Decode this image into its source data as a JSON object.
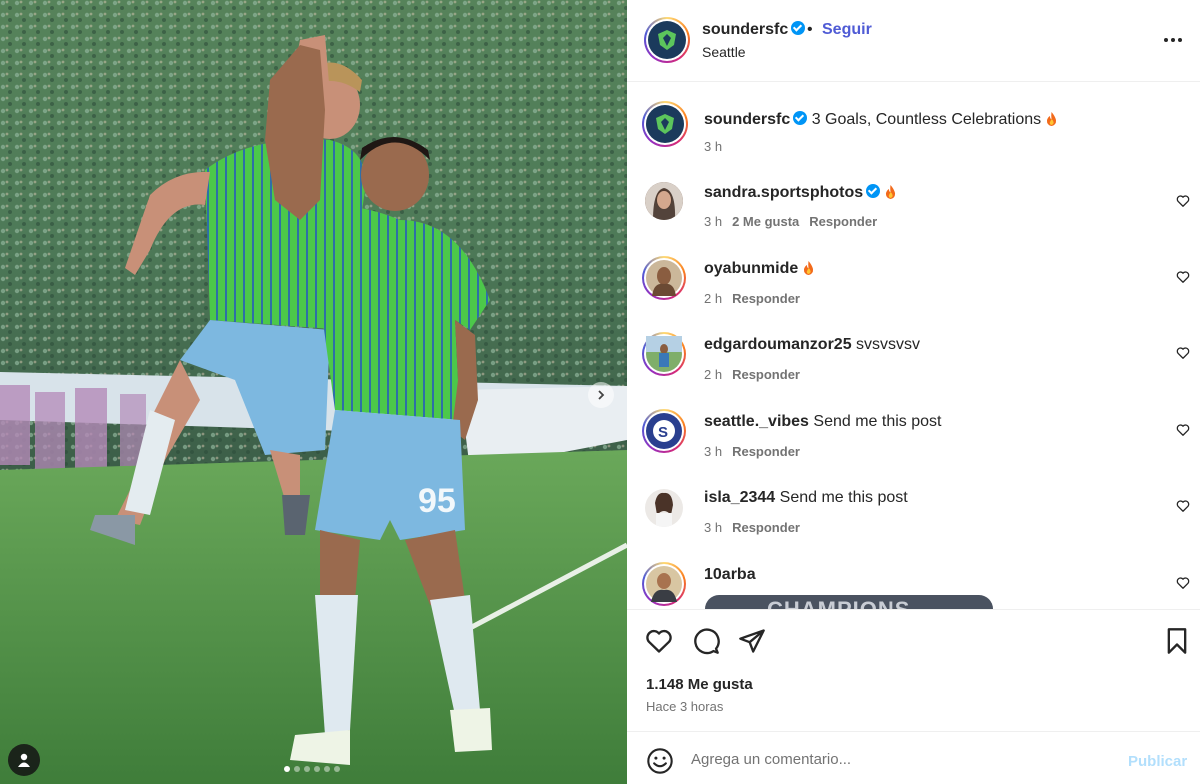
{
  "post": {
    "username": "soundersfc",
    "follow_label": "Seguir",
    "separator": "•",
    "location": "Seattle"
  },
  "caption": {
    "username": "soundersfc",
    "text": "3 Goals, Countless Celebrations",
    "time": "3 h"
  },
  "comments": [
    {
      "username": "sandra.sportsphotos",
      "verified": true,
      "text": "",
      "emoji": "fire",
      "time": "3 h",
      "likes": "2 Me gusta",
      "reply": "Responder"
    },
    {
      "username": "oyabunmide",
      "verified": false,
      "text": "",
      "emoji": "fire",
      "time": "2 h",
      "likes": "",
      "reply": "Responder"
    },
    {
      "username": "edgardoumanzor25",
      "verified": false,
      "text": "svsvsvsv",
      "time": "2 h",
      "likes": "",
      "reply": "Responder"
    },
    {
      "username": "seattle._vibes",
      "verified": false,
      "text": "Send me this post",
      "time": "3 h",
      "likes": "",
      "reply": "Responder"
    },
    {
      "username": "isla_2344",
      "verified": false,
      "text": "Send me this post",
      "time": "3 h",
      "likes": "",
      "reply": "Responder"
    },
    {
      "username": "10arba",
      "verified": false,
      "text": "",
      "time": "",
      "likes": "",
      "reply": ""
    }
  ],
  "comment_image_text": "CHAMPIONS",
  "stats": {
    "likes": "1.148 Me gusta",
    "time_ago": "Hace 3 horas"
  },
  "comment_input": {
    "placeholder": "Agrega un comentario...",
    "publish_label": "Publicar"
  },
  "colors": {
    "follow": "#4f5bd5",
    "verified": "#0095f6",
    "publish_disabled": "#b2dffc",
    "jersey_green": "#4cc84a",
    "shorts_blue": "#7db8e0"
  },
  "carousel": {
    "slide_count": 6,
    "active_index": 0
  },
  "icons": [
    "verified-badge-icon",
    "more-options-icon",
    "heart-icon",
    "comment-icon",
    "share-icon",
    "bookmark-icon",
    "emoji-icon",
    "fire-emoji-icon",
    "chevron-right-icon",
    "user-tag-icon"
  ]
}
